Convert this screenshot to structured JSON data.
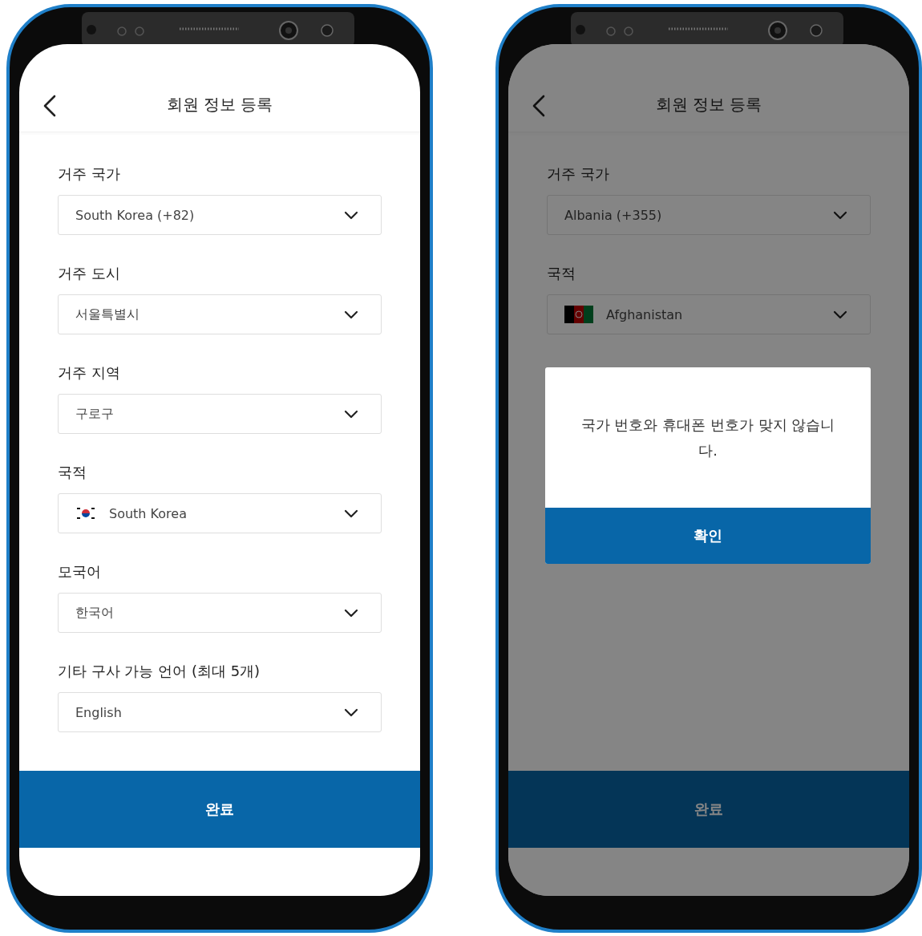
{
  "phones": [
    {
      "title": "회원 정보 등록",
      "fields": [
        {
          "label": "거주 국가",
          "value": "South Korea (+82)",
          "kind": "select"
        },
        {
          "label": "거주 도시",
          "value": "서울특별시",
          "kind": "select"
        },
        {
          "label": "거주 지역",
          "value": "구로구",
          "kind": "select"
        },
        {
          "label": "국적",
          "value": "South Korea",
          "kind": "kr_flag_select"
        },
        {
          "label": "모국어",
          "value": "한국어",
          "kind": "select"
        },
        {
          "label": "기타 구사 가능 언어 (최대 5개)",
          "value": "English",
          "kind": "select"
        }
      ],
      "submit": "완료"
    },
    {
      "title": "회원 정보 등록",
      "fields": [
        {
          "label": "거주 국가",
          "value": "Albania (+355)",
          "kind": "select"
        },
        {
          "label": "국적",
          "value": "Afghanistan",
          "kind": "af_flag_select"
        }
      ],
      "submit": "완료",
      "dialog": {
        "message": "국가 번호와 휴대폰 번호가 맞지 않습니다.",
        "button": "확인"
      }
    }
  ]
}
